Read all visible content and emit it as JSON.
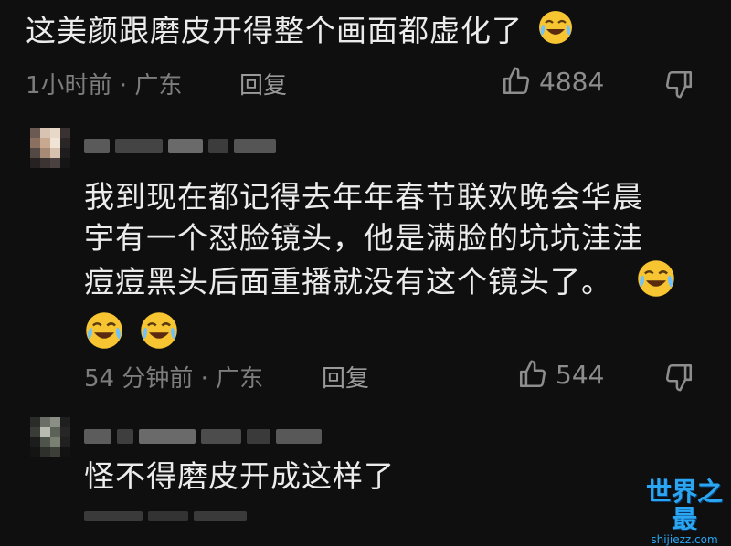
{
  "comments": [
    {
      "text": "这美颜跟磨皮开得整个画面都虚化了",
      "time_location": "1小时前 · 广东",
      "reply_label": "回复",
      "likes": "4884"
    },
    {
      "text_lines": [
        "我到现在都记得去年年春节联欢晚会华晨",
        "宇有一个怼脸镜头，他是满脸的坑坑洼洼",
        "痘痘黑头后面重播就没有这个镜头了。"
      ],
      "time_location": "54 分钟前 · 广东",
      "reply_label": "回复",
      "likes": "544"
    },
    {
      "text": "怪不得磨皮开成这样了"
    }
  ],
  "watermark": {
    "title": "世界之最",
    "url": "shijiezz.com"
  },
  "icons": {
    "like": "thumbs-up-icon",
    "dislike": "thumbs-down-icon",
    "emoji": "tears-of-joy-emoji"
  },
  "colors": {
    "background": "#0f0f10",
    "text": "#ececec",
    "meta": "#7d7d7d",
    "watermark": "#2aa6f3"
  }
}
